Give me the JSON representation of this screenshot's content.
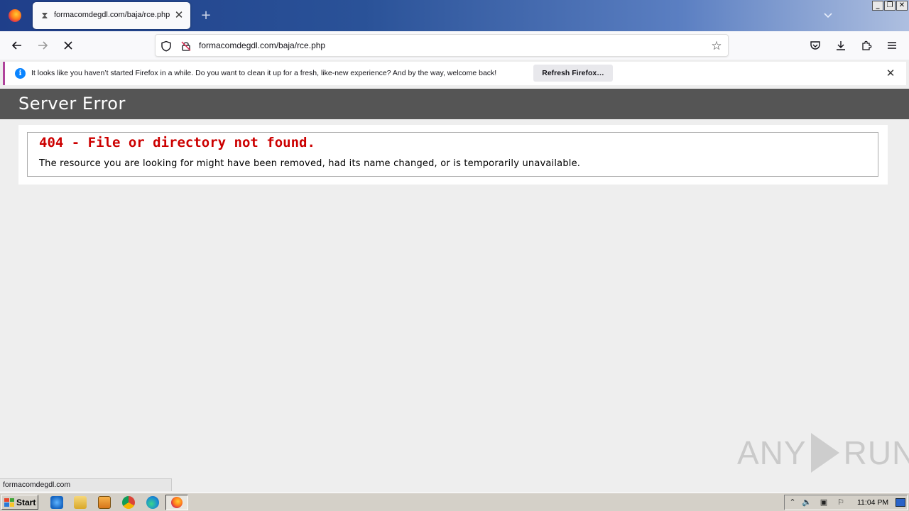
{
  "browser": {
    "tab": {
      "title": "formacomdegdl.com/baja/rce.php"
    },
    "url": "formacomdegdl.com/baja/rce.php",
    "notification": {
      "message": "It looks like you haven’t started Firefox in a while. Do you want to clean it up for a fresh, like-new experience? And by the way, welcome back!",
      "button_label": "Refresh Firefox…"
    },
    "status_link": "formacomdegdl.com"
  },
  "page": {
    "header": "Server Error",
    "error_title": "404 - File or directory not found.",
    "error_description": "The resource you are looking for might have been removed, had its name changed, or is temporarily unavailable."
  },
  "watermark": {
    "left": "ANY",
    "right": "RUN"
  },
  "taskbar": {
    "start_label": "Start",
    "clock": "11:04 PM"
  },
  "colors": {
    "error_red": "#cc0000",
    "header_bg": "#555555",
    "info_blue": "#0a84ff",
    "notif_accent": "#b0449c"
  }
}
